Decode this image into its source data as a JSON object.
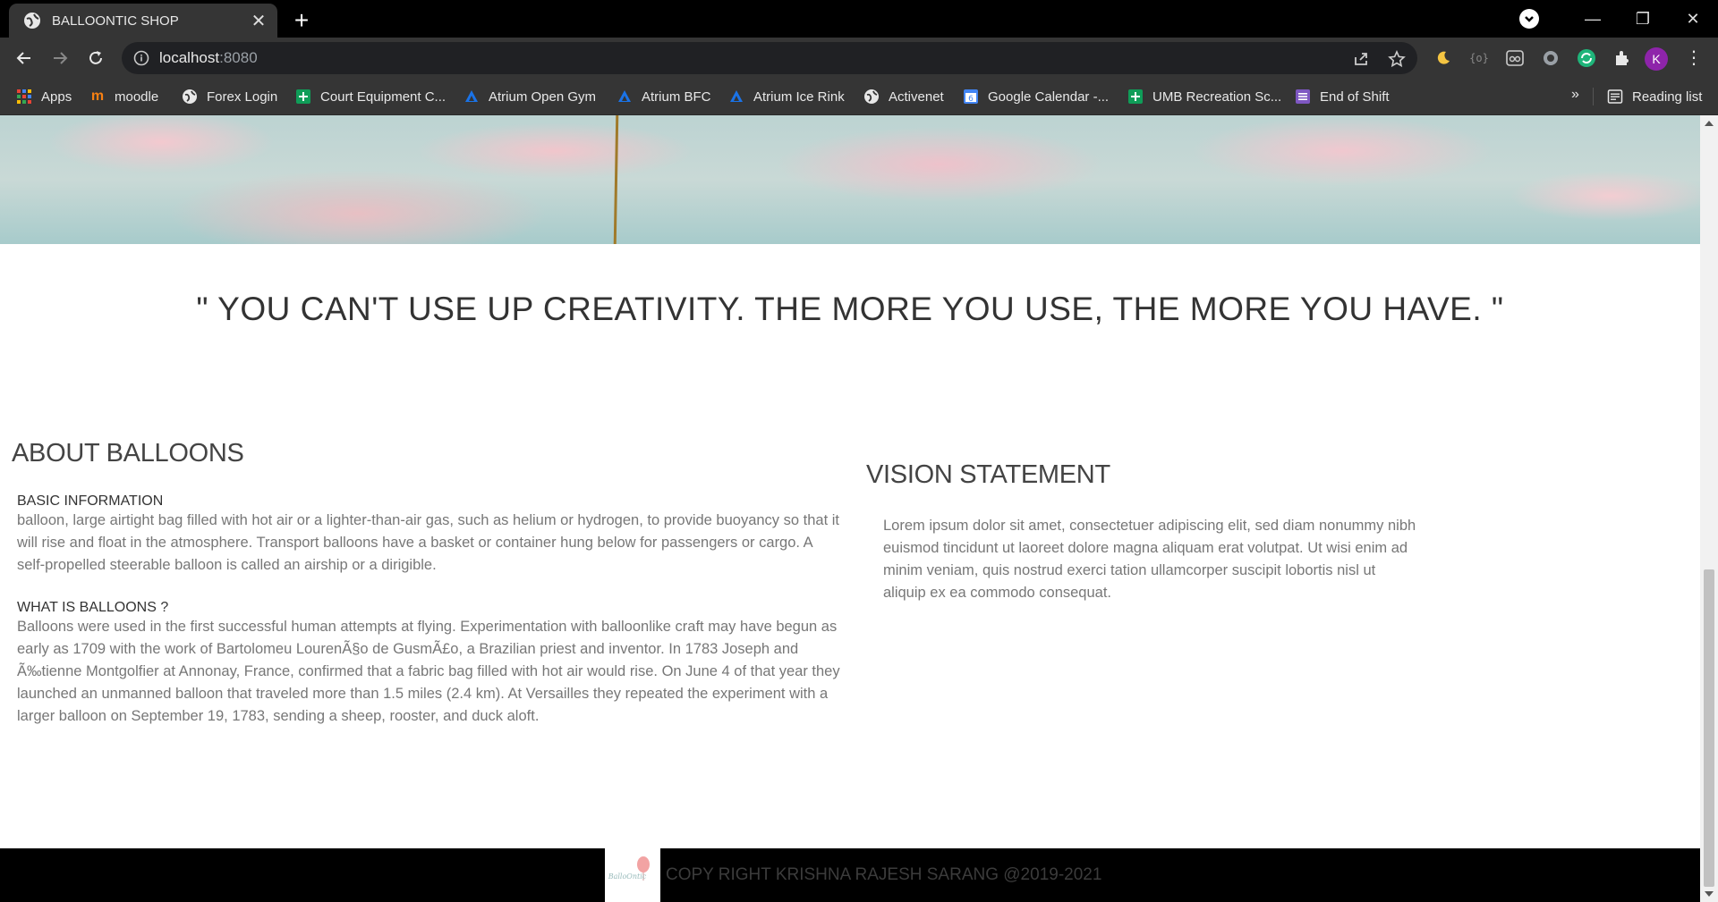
{
  "browser": {
    "tab_title": "BALLOONTIC SHOP",
    "url_host": "localhost",
    "url_port": ":8080",
    "profile_initial": "K",
    "bookmarks": [
      {
        "label": "Apps",
        "icon": "apps-grid-icon"
      },
      {
        "label": "moodle",
        "icon": "moodle-icon"
      },
      {
        "label": "Forex Login",
        "icon": "globe-icon"
      },
      {
        "label": "Court Equipment C...",
        "icon": "sheets-plus-icon"
      },
      {
        "label": "Atrium Open Gym",
        "icon": "atrium-icon"
      },
      {
        "label": "Atrium BFC",
        "icon": "atrium-icon"
      },
      {
        "label": "Atrium Ice Rink",
        "icon": "atrium-icon"
      },
      {
        "label": "Activenet",
        "icon": "globe-icon"
      },
      {
        "label": "Google Calendar -...",
        "icon": "calendar-icon"
      },
      {
        "label": "UMB Recreation Sc...",
        "icon": "sheets-plus-icon"
      },
      {
        "label": "End of Shift",
        "icon": "list-icon"
      }
    ],
    "more_bookmarks": "»",
    "reading_list": "Reading list"
  },
  "page": {
    "quote": "\" YOU CAN'T USE UP CREATIVITY. THE MORE YOU USE, THE MORE YOU HAVE. \"",
    "about": {
      "heading": "ABOUT BALLOONS",
      "basic_title": "BASIC INFORMATION",
      "basic_text": "balloon, large airtight bag filled with hot air or a lighter-than-air gas, such as helium or hydrogen, to provide buoyancy so that it will rise and float in the atmosphere. Transport balloons have a basket or container hung below for passengers or cargo. A self-propelled steerable balloon is called an airship or a dirigible.",
      "what_title": "WHAT IS BALLOONS ?",
      "what_text": "Balloons were used in the first successful human attempts at flying. Experimentation with balloonlike craft may have begun as early as 1709 with the work of Bartolomeu LourenÃ§o de GusmÃ£o, a Brazilian priest and inventor. In 1783 Joseph and Ã‰tienne Montgolfier at Annonay, France, confirmed that a fabric bag filled with hot air would rise. On June 4 of that year they launched an unmanned balloon that traveled more than 1.5 miles (2.4 km). At Versailles they repeated the experiment with a larger balloon on September 19, 1783, sending a sheep, rooster, and duck aloft."
    },
    "vision": {
      "heading": "VISION STATEMENT",
      "text": "Lorem ipsum dolor sit amet, consectetuer adipiscing elit, sed diam nonummy nibh euismod tincidunt ut laoreet dolore magna aliquam erat volutpat. Ut wisi enim ad minim veniam, quis nostrud exerci tation ullamcorper suscipit lobortis nisl ut aliquip ex ea commodo consequat."
    },
    "footer": {
      "copyright": "COPY RIGHT KRISHNA RAJESH SARANG @2019-2021",
      "logo_text": "BalloOntic"
    }
  }
}
